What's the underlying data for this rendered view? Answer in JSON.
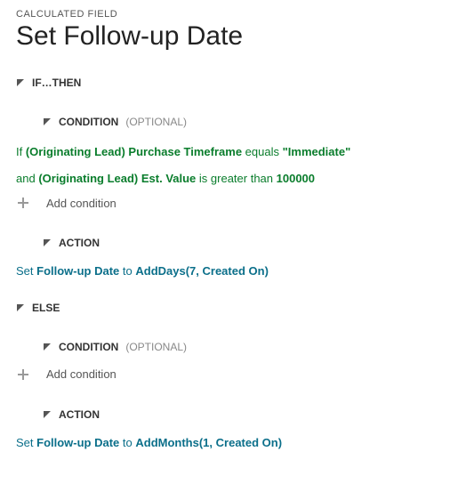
{
  "header": {
    "eyebrow": "CALCULATED FIELD",
    "title": "Set Follow-up Date"
  },
  "labels": {
    "if_then": "IF…THEN",
    "else": "ELSE",
    "condition": "CONDITION",
    "optional": "(OPTIONAL)",
    "action": "ACTION",
    "add_condition": "Add condition"
  },
  "if_branch": {
    "cond1": {
      "prefix": "If ",
      "field": "(Originating Lead) Purchase Timeframe",
      "op": " equals ",
      "value": "\"Immediate\""
    },
    "cond2": {
      "prefix": "and ",
      "field": "(Originating Lead) Est. Value",
      "op": " is greater than ",
      "value": "100000"
    },
    "action": {
      "prefix": "Set ",
      "field": "Follow-up Date",
      "mid": " to ",
      "expr": "AddDays(7, Created On)"
    }
  },
  "else_branch": {
    "action": {
      "prefix": "Set ",
      "field": "Follow-up Date",
      "mid": " to ",
      "expr": "AddMonths(1, Created On)"
    }
  }
}
